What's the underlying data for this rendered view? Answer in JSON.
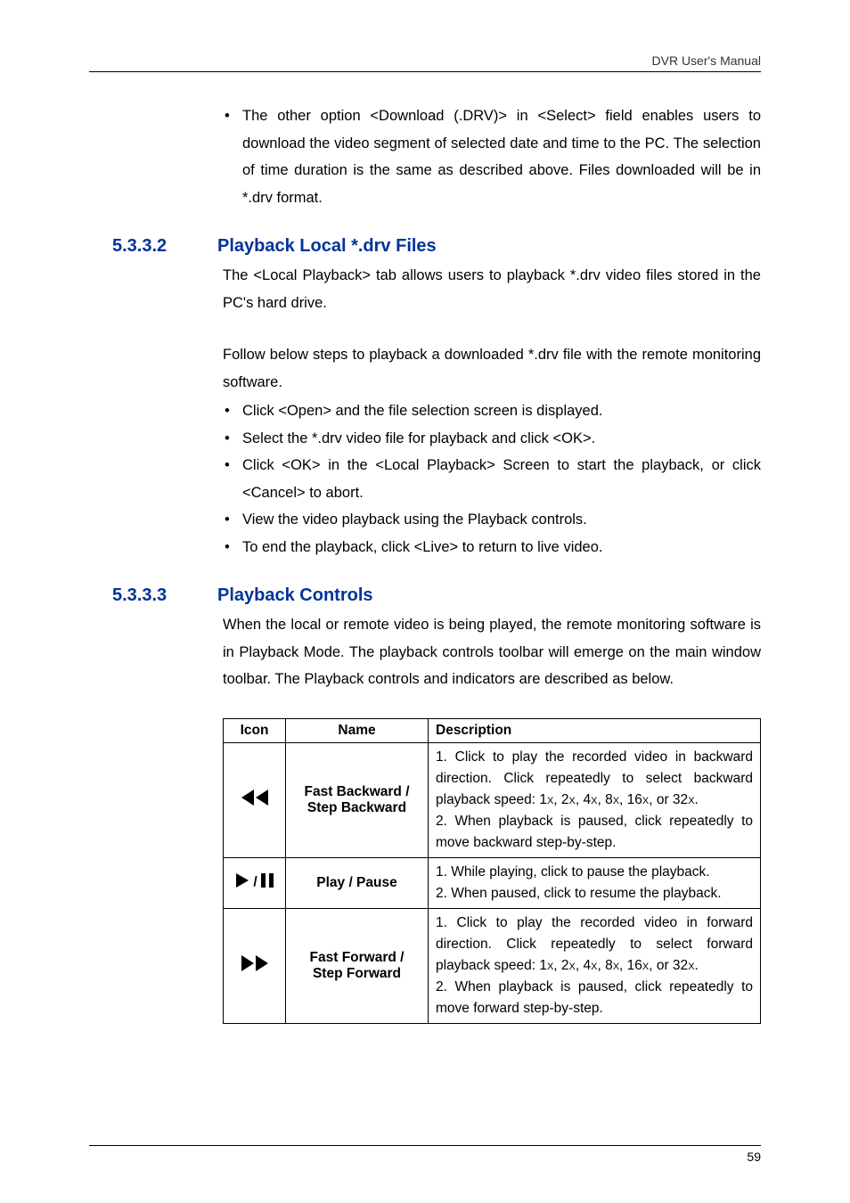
{
  "header": {
    "right": "DVR User's Manual"
  },
  "intro_bullet": "The other option <Download (.DRV)> in <Select> field enables users to download the video segment of selected date and time to the PC. The selection of time duration is the same as described above. Files downloaded will be in *.drv format.",
  "section_5332": {
    "num": "5.3.3.2",
    "title": "Playback Local *.drv Files",
    "para1": "The <Local Playback> tab allows users to playback *.drv video files stored in the PC's hard drive.",
    "para2": "Follow below steps to playback a downloaded *.drv file with the remote monitoring software.",
    "bullets": [
      "Click <Open> and the file selection screen is displayed.",
      "Select the *.drv video file for playback and click <OK>.",
      "Click <OK> in the <Local Playback> Screen to start the playback, or click <Cancel> to abort.",
      "View the video playback using the Playback controls.",
      "To end the playback, click <Live> to return to live video."
    ]
  },
  "section_5333": {
    "num": "5.3.3.3",
    "title": "Playback Controls",
    "para": "When the local or remote video is being played, the remote monitoring software is in Playback Mode. The playback controls toolbar will emerge on the main window toolbar. The Playback controls and indicators are described as below."
  },
  "table": {
    "headers": {
      "icon": "Icon",
      "name": "Name",
      "desc": "Description"
    },
    "rows": [
      {
        "icon": "rewind",
        "name": "Fast Backward / Step Backward",
        "desc_lines": [
          "1. Click to play the recorded video in backward direction. Click repeatedly to select backward playback speed: 1",
          ", 2",
          ", 4",
          ", 8",
          ", 16",
          ", or 32",
          ".",
          "2. When playback is paused, click repeatedly to move backward step-by-step."
        ]
      },
      {
        "icon": "playpause",
        "name": "Play / Pause",
        "desc_lines": [
          "1. While playing, click to pause the playback.",
          "2. When paused, click to resume the playback."
        ]
      },
      {
        "icon": "fastforward",
        "name": "Fast Forward / Step Forward",
        "desc_lines": [
          "1. Click to play the recorded video in forward direction. Click repeatedly to select forward playback speed: 1",
          ", 2",
          ", 4",
          ", 8",
          ", 16",
          ", or 32",
          ".",
          "2. When playback is paused, click repeatedly to move forward step-by-step."
        ]
      }
    ]
  },
  "footer": {
    "page": "59"
  },
  "speed_label": "X"
}
